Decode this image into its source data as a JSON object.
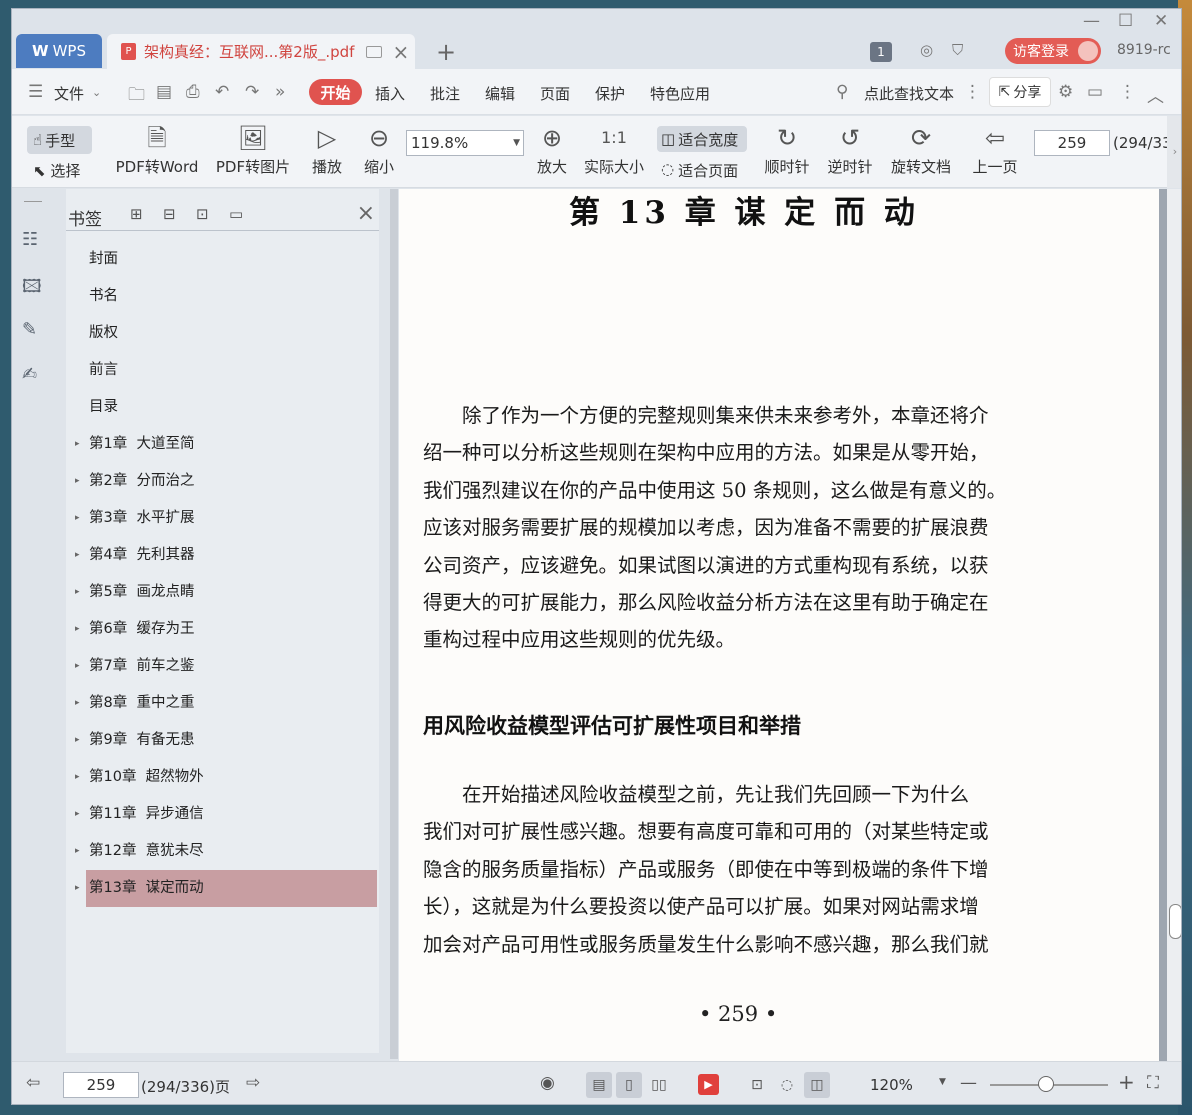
{
  "titlebar": {
    "wps_tab": "WPS",
    "doc_tab_title": "架构真经：互联网...第2版_.pdf",
    "page_badge": "1",
    "login_label": "访客登录",
    "version": "8919-rc"
  },
  "menu": {
    "file": "文件",
    "start": "开始",
    "insert": "插入",
    "annotate": "批注",
    "edit": "编辑",
    "page": "页面",
    "protect": "保护",
    "special": "特色应用",
    "search": "点此查找文本",
    "share": "分享"
  },
  "toolbar": {
    "hand": "手型",
    "select": "选择",
    "pdf_to_word": "PDF转Word",
    "pdf_to_image": "PDF转图片",
    "play": "播放",
    "zoom_out": "缩小",
    "zoom_value": "119.8%",
    "zoom_in": "放大",
    "actual_size": "实际大小",
    "fit_width": "适合宽度",
    "fit_page": "适合页面",
    "rotate_cw": "顺时针",
    "rotate_ccw": "逆时针",
    "rotate_doc": "旋转文档",
    "prev_page": "上一页",
    "page_input": "259",
    "page_total": "(294/33"
  },
  "bookmarks": {
    "title": "书签",
    "items": [
      {
        "label": "封面",
        "arrow": ""
      },
      {
        "label": "书名",
        "arrow": ""
      },
      {
        "label": "版权",
        "arrow": ""
      },
      {
        "label": "前言",
        "arrow": ""
      },
      {
        "label": "目录",
        "arrow": ""
      },
      {
        "label": "第1章  大道至简",
        "arrow": "▸"
      },
      {
        "label": "第2章  分而治之",
        "arrow": "▸"
      },
      {
        "label": "第3章  水平扩展",
        "arrow": "▸"
      },
      {
        "label": "第4章  先利其器",
        "arrow": "▸"
      },
      {
        "label": "第5章  画龙点睛",
        "arrow": "▸"
      },
      {
        "label": "第6章  缓存为王",
        "arrow": "▸"
      },
      {
        "label": "第7章  前车之鉴",
        "arrow": "▸"
      },
      {
        "label": "第8章  重中之重",
        "arrow": "▸"
      },
      {
        "label": "第9章  有备无患",
        "arrow": "▸"
      },
      {
        "label": "第10章  超然物外",
        "arrow": "▸"
      },
      {
        "label": "第11章  异步通信",
        "arrow": "▸"
      },
      {
        "label": "第12章  意犹未尽",
        "arrow": "▸"
      },
      {
        "label": "第13章  谋定而动",
        "arrow": "▸",
        "selected": true
      }
    ]
  },
  "document": {
    "chapter_title": "第 13 章   谋 定 而 动",
    "para1": [
      "除了作为一个方便的完整规则集来供未来参考外，本章还将介",
      "绍一种可以分析这些规则在架构中应用的方法。如果是从零开始，",
      "我们强烈建议在你的产品中使用这 50 条规则，这么做是有意义的。",
      "应该对服务需要扩展的规模加以考虑，因为准备不需要的扩展浪费",
      "公司资产，应该避免。如果试图以演进的方式重构现有系统，以获",
      "得更大的可扩展能力，那么风险收益分析方法在这里有助于确定在",
      "重构过程中应用这些规则的优先级。"
    ],
    "section_heading": "用风险收益模型评估可扩展性项目和举措",
    "para2": [
      "在开始描述风险收益模型之前，先让我们先回顾一下为什么",
      "我们对可扩展性感兴趣。想要有高度可靠和可用的（对某些特定或",
      "隐含的服务质量指标）产品或服务（即使在中等到极端的条件下增",
      "长），这就是为什么要投资以使产品可以扩展。如果对网站需求增",
      "加会对产品可用性或服务质量发生什么影响不感兴趣，那么我们就"
    ],
    "page_number": "• 259 •"
  },
  "statusbar": {
    "page_input": "259",
    "page_info": "(294/336)页",
    "zoom": "120%"
  }
}
